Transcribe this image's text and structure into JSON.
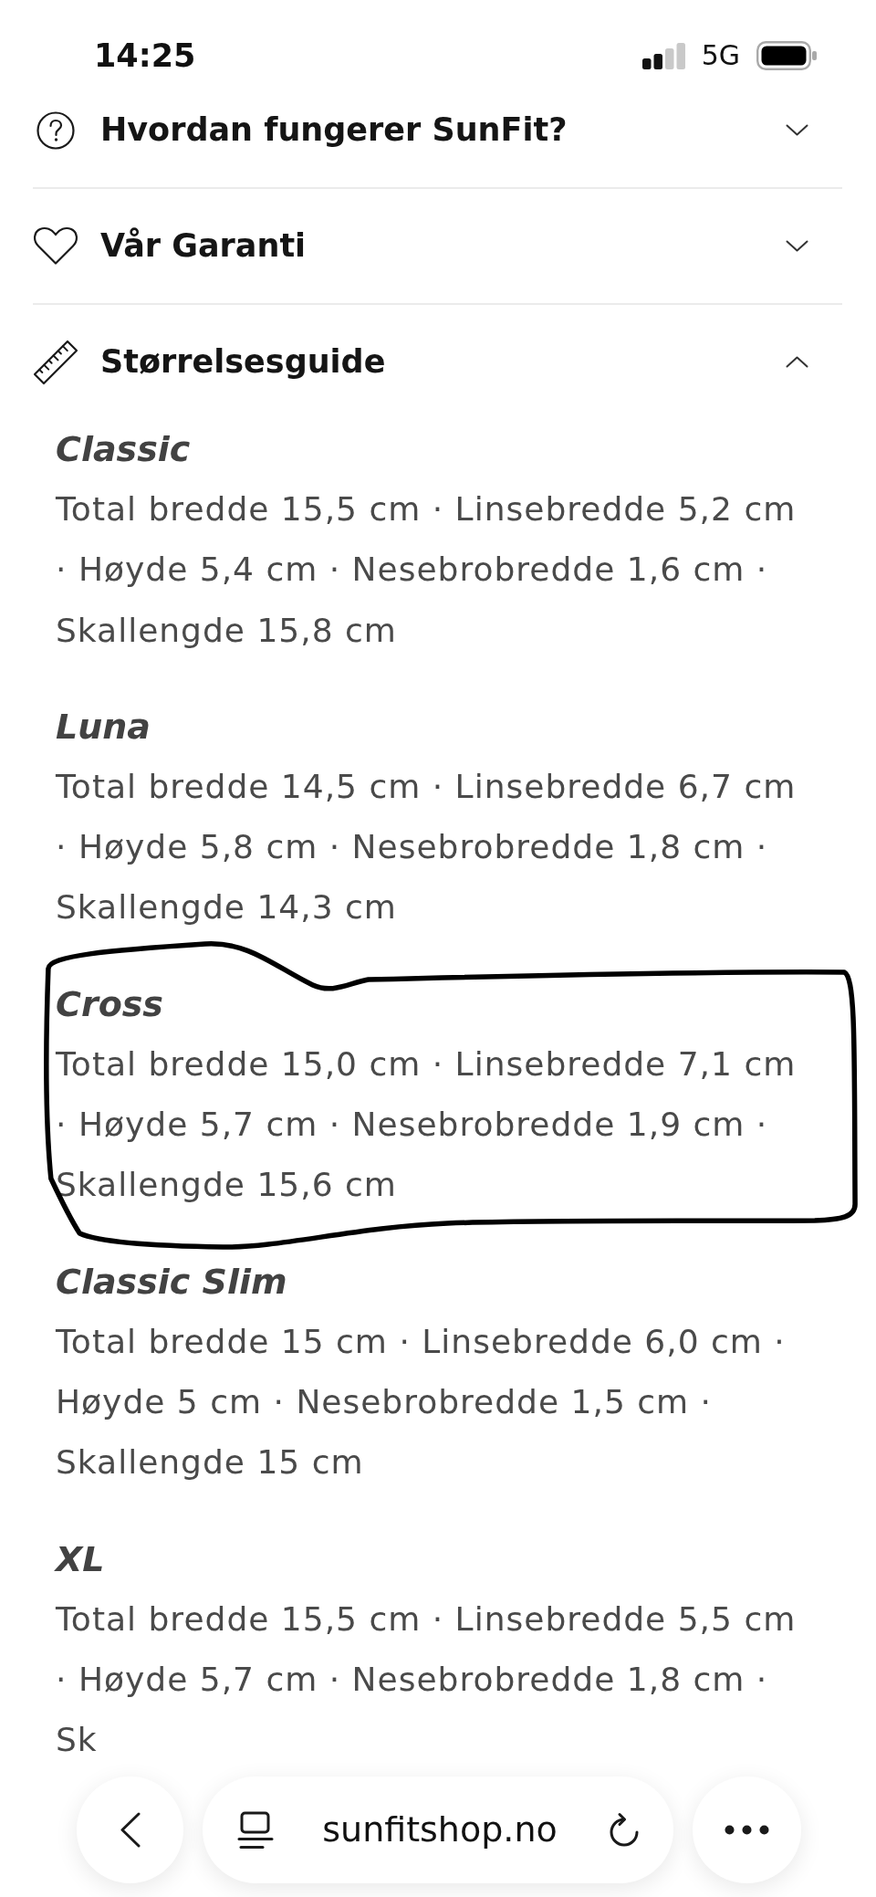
{
  "status_bar": {
    "time": "14:25",
    "network": "5G"
  },
  "sections": [
    {
      "title": "Hvordan fungerer SunFit?",
      "expanded": false
    },
    {
      "title": "Vår Garanti",
      "expanded": false
    },
    {
      "title": "Størrelsesguide",
      "expanded": true,
      "models": [
        {
          "name": "Classic",
          "specs": "Total bredde 15,5 cm · Linsebredde 5,2 cm · Høyde 5,4 cm · Nesebrobredde 1,6 cm · Skallengde 15,8 cm",
          "circled": false
        },
        {
          "name": "Luna",
          "specs": "Total bredde 14,5 cm · Linsebredde 6,7 cm · Høyde 5,8 cm · Nesebrobredde 1,8 cm · Skallengde 14,3 cm",
          "circled": false
        },
        {
          "name": "Cross",
          "specs": "Total bredde 15,0 cm · Linsebredde 7,1 cm · Høyde 5,7 cm · Nesebrobredde 1,9 cm · Skallengde 15,6 cm",
          "circled": true
        },
        {
          "name": "Classic Slim",
          "specs": "Total bredde 15 cm · Linsebredde 6,0 cm · Høyde 5 cm · Nesebrobredde 1,5 cm · Skallengde 15 cm",
          "circled": false
        },
        {
          "name": "XL",
          "specs": "Total bredde 15,5 cm · Linsebredde 5,5 cm · Høyde 5,7 cm · Nesebrobredde 1,8 cm · Sk",
          "circled": false
        }
      ]
    }
  ],
  "browser_toolbar": {
    "url": "sunfitshop.no"
  }
}
